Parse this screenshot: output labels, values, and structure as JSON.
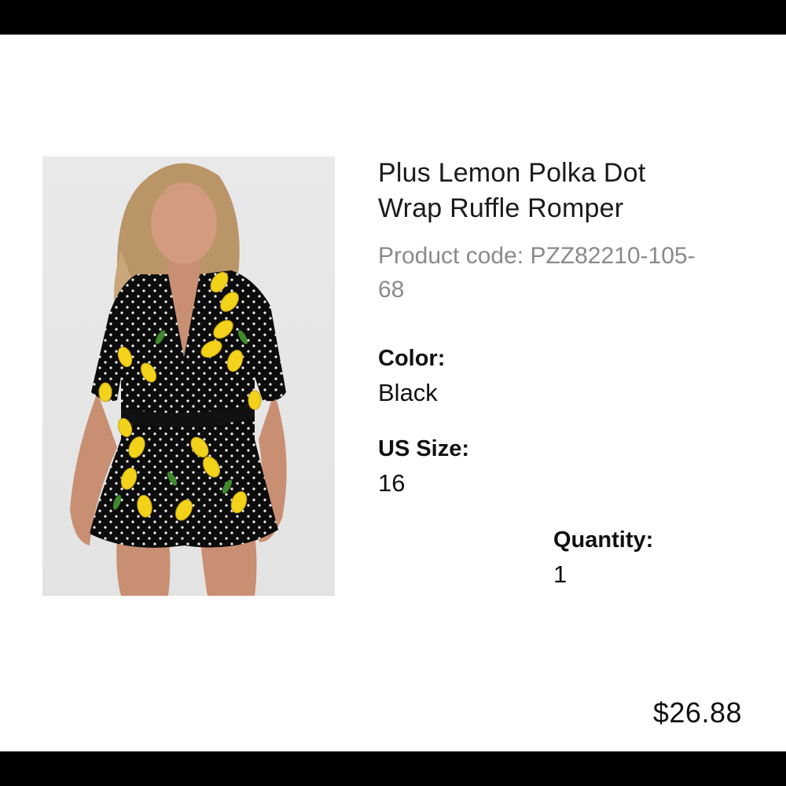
{
  "product": {
    "title": "Plus Lemon Polka Dot Wrap Ruffle Romper",
    "code_text": "Product code: PZZ82210-105-68",
    "image": "model-wearing-black-lemon-polka-dot-romper"
  },
  "details": {
    "color_label": "Color:",
    "color_value": "Black",
    "size_label": "US Size:",
    "size_value": "16",
    "quantity_label": "Quantity:",
    "quantity_value": "1"
  },
  "price": "$26.88",
  "colors": {
    "bar": "#000000",
    "code_text": "#8a8a8a",
    "garment": "#0c0c0c",
    "lemon": "#f2d21b"
  }
}
